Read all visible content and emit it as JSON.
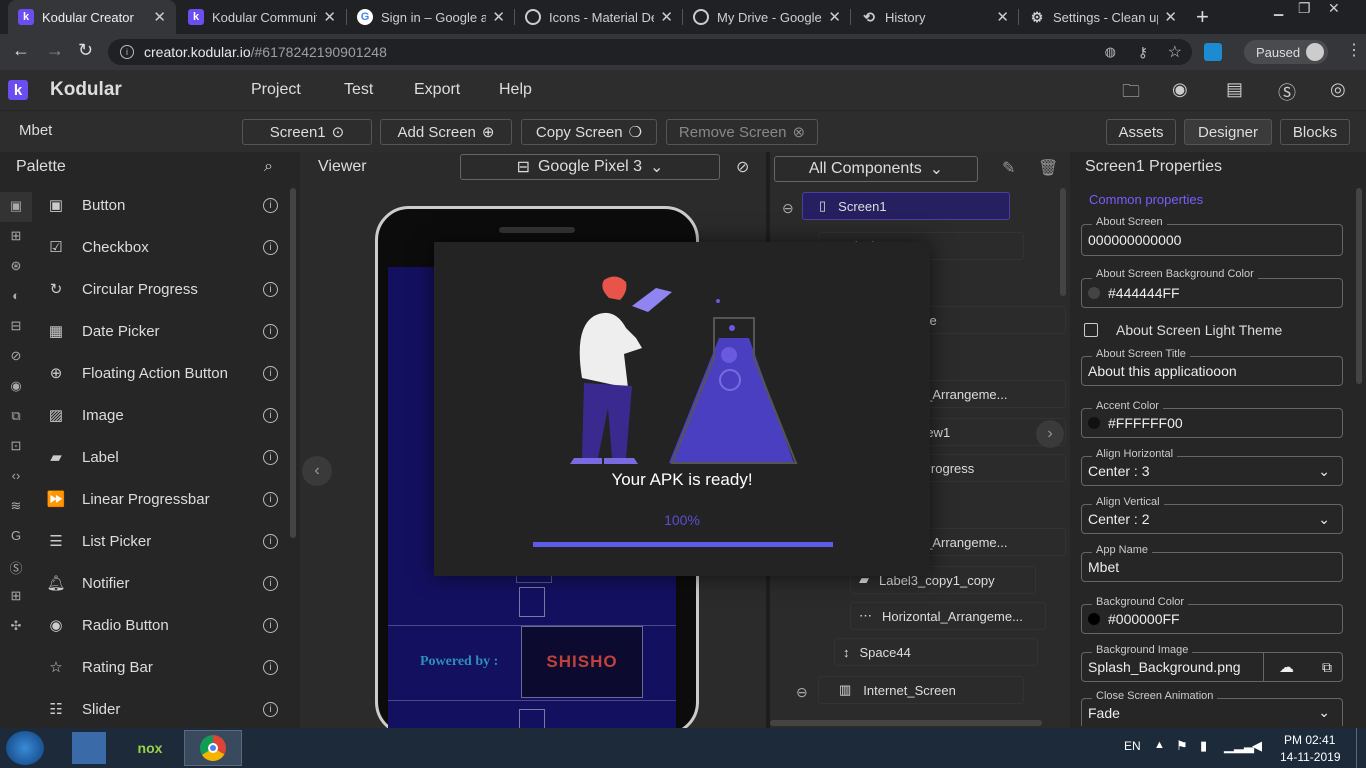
{
  "browser": {
    "tabs": [
      {
        "title": "Kodular Creator",
        "active": true
      },
      {
        "title": "Kodular Community"
      },
      {
        "title": "Sign in – Google ac"
      },
      {
        "title": "Icons - Material De"
      },
      {
        "title": "My Drive - Google D"
      },
      {
        "title": "History"
      },
      {
        "title": "Settings - Clean up"
      }
    ],
    "url_host": "creator.kodular.io",
    "url_path": "/#6178242190901248",
    "profile_label": "Paused"
  },
  "app": {
    "name": "Kodular",
    "menu": [
      "Project",
      "Test",
      "Export",
      "Help"
    ],
    "project_name": "Mbet",
    "screen_select": "Screen1",
    "add_screen": "Add Screen",
    "copy_screen": "Copy Screen",
    "remove_screen": "Remove Screen",
    "view_tabs": [
      "Assets",
      "Designer",
      "Blocks"
    ]
  },
  "palette": {
    "title": "Palette",
    "items": [
      {
        "label": "Button",
        "icon": "button-icon"
      },
      {
        "label": "Checkbox",
        "icon": "checkbox-icon"
      },
      {
        "label": "Circular Progress",
        "icon": "circular-progress-icon"
      },
      {
        "label": "Date Picker",
        "icon": "date-picker-icon"
      },
      {
        "label": "Floating Action Button",
        "icon": "fab-icon"
      },
      {
        "label": "Image",
        "icon": "image-icon"
      },
      {
        "label": "Label",
        "icon": "label-icon"
      },
      {
        "label": "Linear Progressbar",
        "icon": "linear-progressbar-icon"
      },
      {
        "label": "List Picker",
        "icon": "list-picker-icon"
      },
      {
        "label": "Notifier",
        "icon": "notifier-icon"
      },
      {
        "label": "Radio Button",
        "icon": "radio-button-icon"
      },
      {
        "label": "Rating Bar",
        "icon": "rating-bar-icon"
      },
      {
        "label": "Slider",
        "icon": "slider-icon"
      }
    ]
  },
  "viewer": {
    "title": "Viewer",
    "device": "Google Pixel 3",
    "powered_by": "Powered by :",
    "logo_text": "SHISHO"
  },
  "components": {
    "filter": "All Components",
    "tree": [
      {
        "label": "Screen1",
        "selected": true
      },
      {
        "label": "Splash_Screen"
      },
      {
        "label": "nge"
      },
      {
        "label": "al_Arrangeme..."
      },
      {
        "label": "View1"
      },
      {
        "label": "_Progress"
      },
      {
        "label": "al_Arrangeme..."
      },
      {
        "label": "Label3_copy1_copy"
      },
      {
        "label": "Horizontal_Arrangeme..."
      },
      {
        "label": "Space44"
      },
      {
        "label": "Internet_Screen"
      }
    ]
  },
  "properties": {
    "title": "Screen1 Properties",
    "section": "Common properties",
    "about_screen": {
      "label": "About Screen",
      "value": "000000000000"
    },
    "about_bg": {
      "label": "About Screen Background Color",
      "value": "#444444FF"
    },
    "about_light": {
      "label": "About Screen Light Theme"
    },
    "about_title": {
      "label": "About Screen Title",
      "value": "About this applicatiooon"
    },
    "accent": {
      "label": "Accent Color",
      "value": "#FFFFFF00"
    },
    "align_h": {
      "label": "Align Horizontal",
      "value": "Center : 3"
    },
    "align_v": {
      "label": "Align Vertical",
      "value": "Center : 2"
    },
    "app_name": {
      "label": "App Name",
      "value": "Mbet"
    },
    "bg_color": {
      "label": "Background Color",
      "value": "#000000FF"
    },
    "bg_image": {
      "label": "Background Image",
      "value": "Splash_Background.png"
    },
    "close_anim": {
      "label": "Close Screen Animation",
      "value": "Fade"
    }
  },
  "modal": {
    "message": "Your APK is ready!",
    "progress_text": "100%",
    "progress": 1.0
  },
  "taskbar": {
    "lang": "EN",
    "time": "PM 02:41",
    "date": "14-11-2019"
  },
  "colors": {
    "accent": "#7c4dff",
    "progress": "#5c5ce6"
  }
}
